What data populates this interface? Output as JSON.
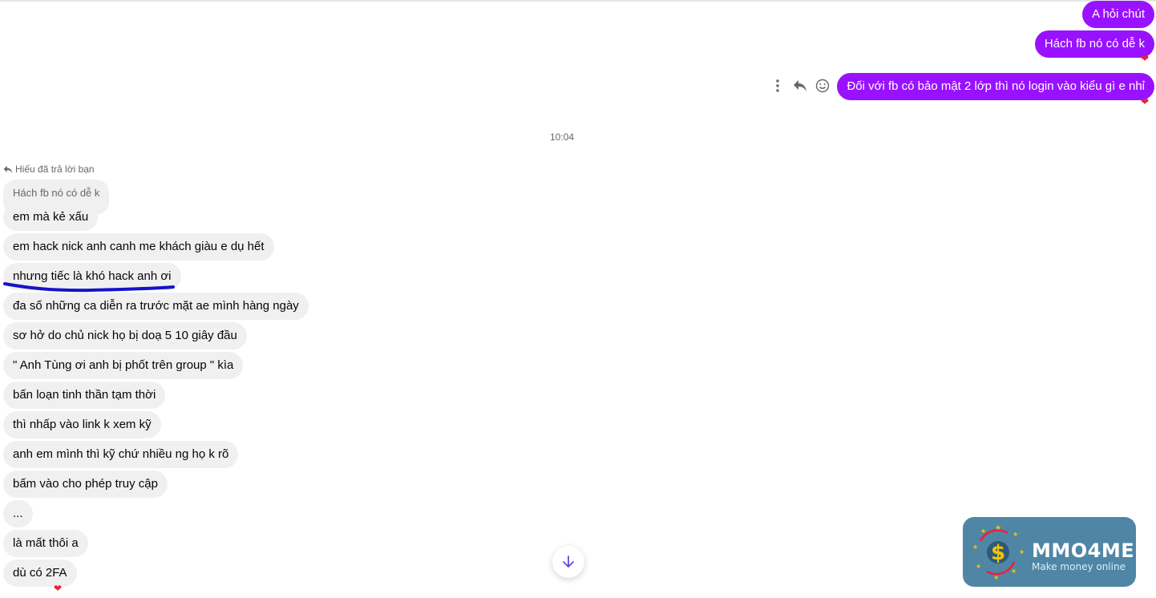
{
  "outgoing": [
    {
      "text": "A hỏi chút"
    },
    {
      "text": "Hách fb nó có dễ k"
    },
    {
      "text": "Đối với fb có bảo mật 2 lớp thì nó login vào kiểu gì e nhỉ"
    }
  ],
  "timestamp": "10:04",
  "reply": {
    "note": "Hiếu đã trả lời bạn",
    "quoted": "Hách fb nó có dễ k"
  },
  "incoming": [
    {
      "text": "em mà kẻ xấu"
    },
    {
      "text": "em hack nick anh canh me khách giàu e dụ hết"
    },
    {
      "text": "nhưng tiếc là khó hack anh ơi"
    },
    {
      "text": "đa số những ca diễn ra trước mặt ae mình hàng ngày"
    },
    {
      "text": "sơ hở do chủ nick họ bị doạ 5 10 giây đầu"
    },
    {
      "text": "\" Anh Tùng ơi anh bị phốt trên group \" kìa"
    },
    {
      "text": "bấn loạn tinh thần tạm thời"
    },
    {
      "text": "thì nhấp vào link k xem kỹ"
    },
    {
      "text": "anh em mình thì kỹ chứ nhiều ng họ k rõ"
    },
    {
      "text": "bấm vào cho phép truy cập"
    },
    {
      "text": "..."
    },
    {
      "text": "là mất thôi a"
    },
    {
      "text": "dù có 2FA"
    }
  ],
  "icons": {
    "more": "more-vertical-icon",
    "reply": "reply-icon",
    "react": "smiley-icon",
    "reaction": "heart-icon",
    "scroll": "arrow-down-icon"
  },
  "colors": {
    "outgoing_bubble": "#9912ff",
    "incoming_bubble": "#f0f0f0",
    "heart": "#e8213b",
    "underline": "#1414c8"
  },
  "watermark": {
    "title": "MMO4ME",
    "subtitle": "Make money online"
  }
}
